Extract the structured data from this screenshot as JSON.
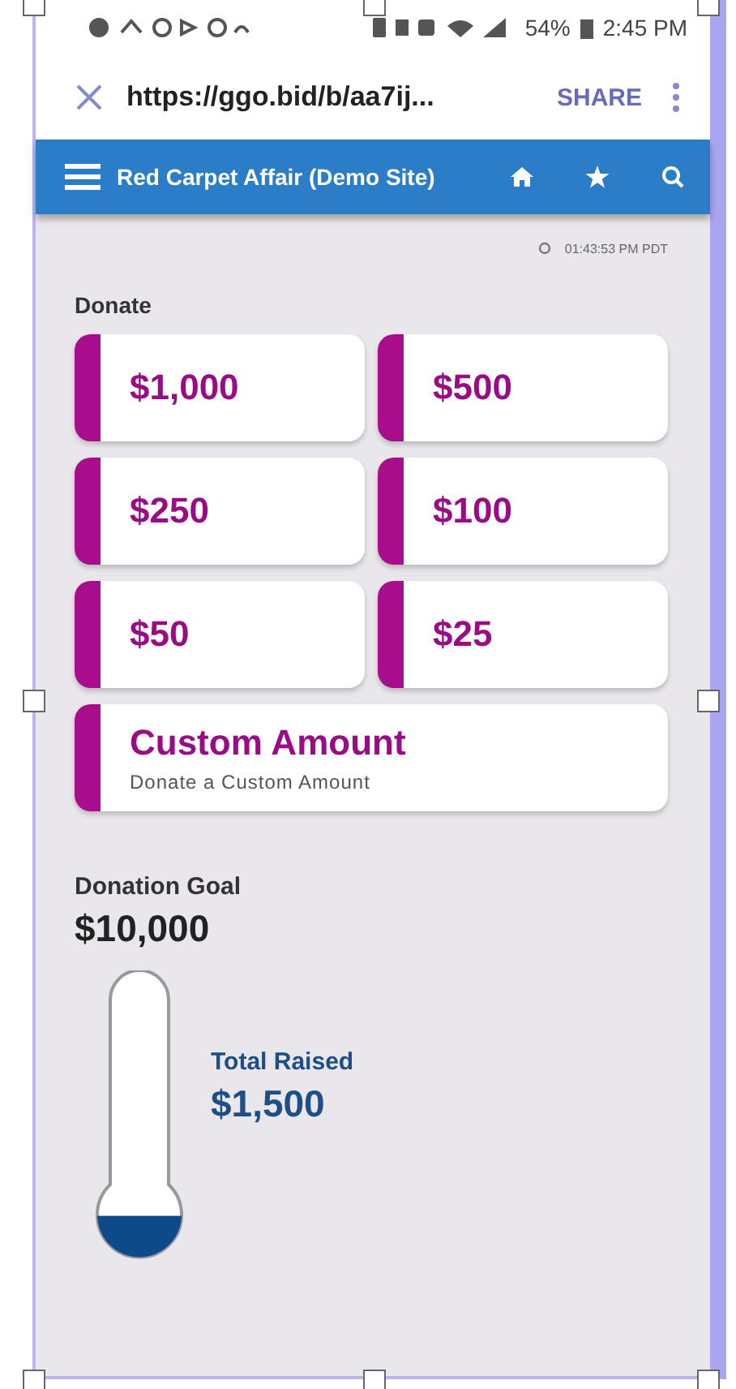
{
  "status_bar": {
    "battery": "54%",
    "time": "2:45 PM"
  },
  "browser_bar": {
    "url": "https://ggo.bid/b/aa7ij...",
    "share": "SHARE"
  },
  "app_bar": {
    "title": "Red Carpet Affair (Demo Site)"
  },
  "timestamp": "01:43:53 PM PDT",
  "donate": {
    "heading": "Donate",
    "amounts": [
      {
        "label": "$1,000"
      },
      {
        "label": "$500"
      },
      {
        "label": "$250"
      },
      {
        "label": "$100"
      },
      {
        "label": "$50"
      },
      {
        "label": "$25"
      }
    ],
    "custom": {
      "title": "Custom Amount",
      "subtitle": "Donate a Custom Amount"
    }
  },
  "goal": {
    "label": "Donation Goal",
    "amount": "$10,000"
  },
  "thermometer": {
    "level": 0.15,
    "label": "Total Raised",
    "amount": "$1,500"
  }
}
